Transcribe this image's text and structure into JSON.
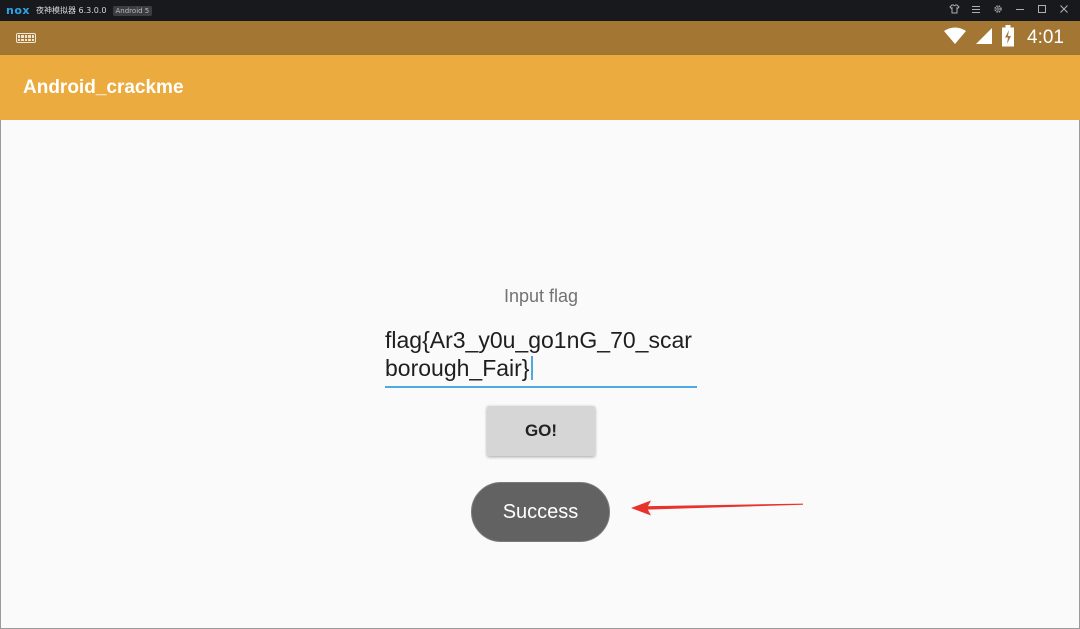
{
  "emulator": {
    "logo": "nox",
    "title": "夜神模拟器 6.3.0.0",
    "android_badge": "Android 5",
    "controls": [
      "shirt-icon",
      "menu-icon",
      "gear-icon",
      "minimize-icon",
      "maximize-icon",
      "close-icon"
    ]
  },
  "status_bar": {
    "time": "4:01",
    "icons": [
      "keyboard-icon",
      "wifi-icon",
      "signal-icon",
      "battery-charging-icon"
    ]
  },
  "app_bar": {
    "title": "Android_crackme"
  },
  "main": {
    "input_label": "Input flag",
    "flag_value": "flag{Ar3_y0u_go1nG_70_scarborough_Fair}",
    "go_button": "GO!",
    "toast": "Success"
  },
  "annotation": {
    "arrow_color": "#e8332d"
  },
  "colors": {
    "status_bar": "#a47634",
    "app_bar": "#ebab3e",
    "input_underline": "#4fa8de",
    "toast_bg": "#626262"
  }
}
